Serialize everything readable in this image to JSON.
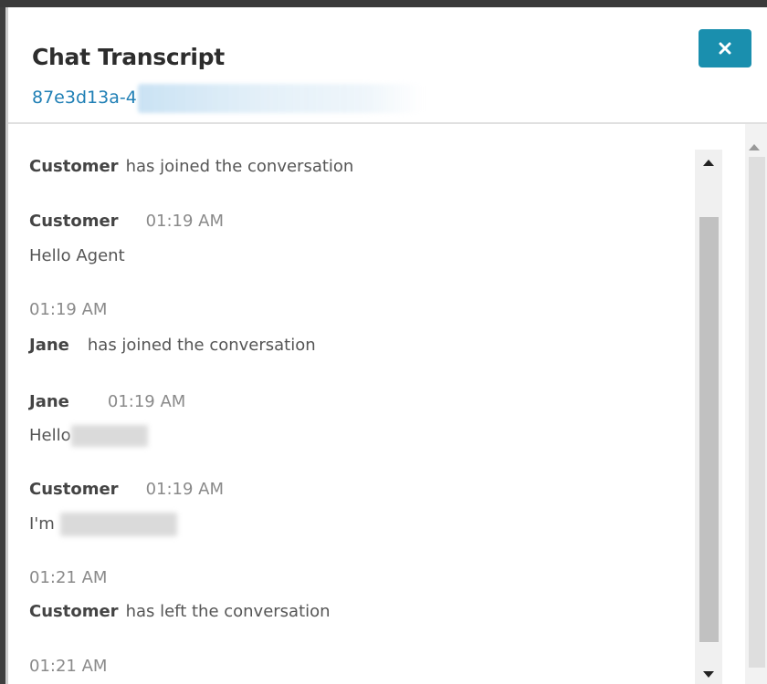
{
  "dialog": {
    "title": "Chat Transcript",
    "contact_id_visible": "87e3d13a-4",
    "close_label": "×"
  },
  "messages": [
    {
      "sender": "Customer",
      "text": "has joined the conversation"
    },
    {
      "sender": "Customer",
      "time": "01:19 AM",
      "text": "Hello Agent"
    },
    {
      "time": "01:19 AM",
      "sender": "Jane",
      "text": "has joined the conversation"
    },
    {
      "sender": "Jane",
      "time": "01:19 AM",
      "text": "Hello"
    },
    {
      "sender": "Customer",
      "time": "01:19 AM",
      "text": "I'm"
    },
    {
      "time": "01:21 AM",
      "sender": "Customer",
      "text": "has left the conversation"
    },
    {
      "time": "01:21 AM"
    }
  ],
  "colors": {
    "accent": "#1a8fae",
    "link": "#1f7fb5",
    "header_text": "#2d2d2d"
  },
  "icons": {
    "close": "close-icon",
    "scroll_up": "arrow-up-icon",
    "scroll_down": "arrow-down-icon"
  }
}
